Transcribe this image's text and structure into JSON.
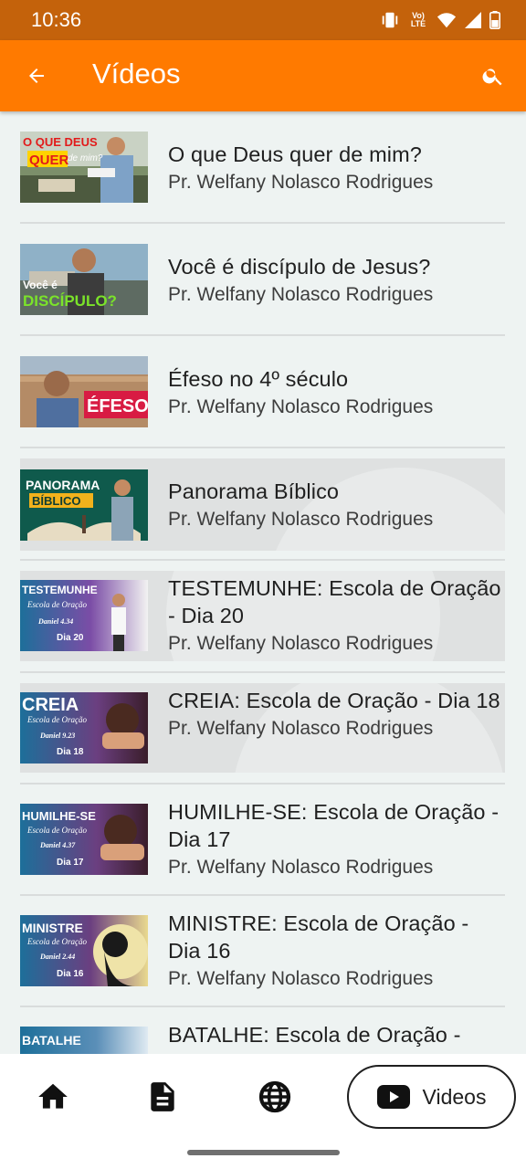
{
  "status_bar": {
    "time": "10:36",
    "network_label": "Vo) LTE"
  },
  "app_bar": {
    "title": "Vídeos",
    "back_icon": "arrow-back-icon",
    "search_icon": "search-icon"
  },
  "videos": [
    {
      "title": "O que Deus quer de mim?",
      "author": "Pr. Welfany Nolasco Rodrigues",
      "thumb_text": [
        "O QUE DEUS",
        "QUER",
        "de mim?"
      ]
    },
    {
      "title": "Você é discípulo de Jesus?",
      "author": "Pr. Welfany Nolasco Rodrigues",
      "thumb_text": [
        "Você é",
        "DISCÍPULO?"
      ]
    },
    {
      "title": "Éfeso no 4º século",
      "author": "Pr. Welfany Nolasco Rodrigues",
      "thumb_text": [
        "ÉFESO"
      ]
    },
    {
      "title": "Panorama Bíblico",
      "author": "Pr. Welfany Nolasco Rodrigues",
      "thumb_text": [
        "PANORAMA",
        "BÍBLICO"
      ]
    },
    {
      "title": "TESTEMUNHE: Escola de Oração - Dia 20",
      "author": "Pr. Welfany Nolasco Rodrigues",
      "thumb_text": [
        "TESTEMUNHE",
        "Escola de Oração",
        "Daniel 4.34",
        "Dia 20"
      ]
    },
    {
      "title": "CREIA: Escola de Oração - Dia 18",
      "author": "Pr. Welfany Nolasco Rodrigues",
      "thumb_text": [
        "CREIA",
        "Escola de Oração",
        "Daniel 9.23",
        "Dia 18"
      ]
    },
    {
      "title": "HUMILHE-SE: Escola de Oração - Dia 17",
      "author": "Pr. Welfany Nolasco Rodrigues",
      "thumb_text": [
        "HUMILHE-SE",
        "Escola de Oração",
        "Daniel 4.37",
        "Dia 17"
      ]
    },
    {
      "title": "MINISTRE: Escola de Oração - Dia 16",
      "author": "Pr. Welfany Nolasco Rodrigues",
      "thumb_text": [
        "MINISTRE",
        "Escola de Oração",
        "Daniel 2.44",
        "Dia 16"
      ]
    },
    {
      "title": "BATALHE: Escola de Oração -",
      "author": "",
      "thumb_text": [
        "BATALHE"
      ]
    }
  ],
  "bottom_nav": {
    "items": [
      {
        "icon": "home-icon"
      },
      {
        "icon": "document-icon"
      },
      {
        "icon": "globe-icon"
      },
      {
        "icon": "youtube-icon",
        "label": "Videos",
        "selected": true
      }
    ]
  },
  "colors": {
    "status_bar": "#c4620b",
    "app_bar": "#ff7a00",
    "list_background": "#eef3f2",
    "highlight": "#dfe1e1"
  }
}
